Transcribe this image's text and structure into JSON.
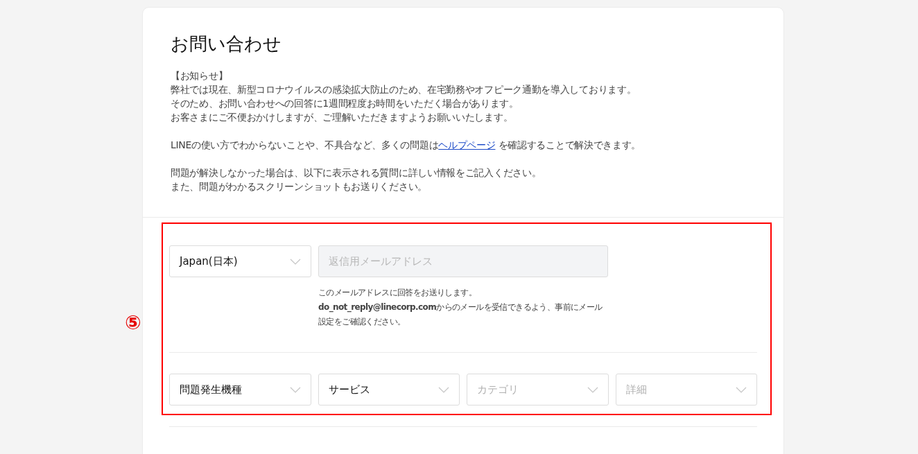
{
  "page": {
    "title": "お問い合わせ"
  },
  "notice": [
    "【お知らせ】",
    "弊社では現在、新型コロナウイルスの感染拡大防止のため、在宅勤務やオフピーク通勤を導入しております。",
    "そのため、お問い合わせへの回答に1週間程度お時間をいただく場合があります。",
    "お客さまにご不便おかけしますが、ご理解いただきますようお願いいたします。"
  ],
  "help_line": {
    "before": "LINEの使い方でわからないことや、不具合など、多くの問題は",
    "link": "ヘルプページ",
    "after": " を確認することで解決できます。"
  },
  "instructions": [
    "問題が解決しなかった場合は、以下に表示される質問に詳しい情報をご記入ください。",
    "また、問題がわかるスクリーンショットもお送りください。"
  ],
  "annotation": {
    "marker": "⑤"
  },
  "country_select": {
    "value": "Japan(日本)",
    "disabled": false
  },
  "email_field": {
    "placeholder": "返信用メールアドレス",
    "disabled": true
  },
  "email_help": [
    "このメールアドレスに回答をお送りします。",
    "**do_not_reply@linecorp.com**からのメールを受信できるよう、事前にメール設定をご確認ください。"
  ],
  "category_selects": [
    {
      "label": "問題発生機種",
      "disabled": false
    },
    {
      "label": "サービス",
      "disabled": false
    },
    {
      "label": "カテゴリ",
      "disabled": true
    },
    {
      "label": "詳細",
      "disabled": true
    }
  ]
}
